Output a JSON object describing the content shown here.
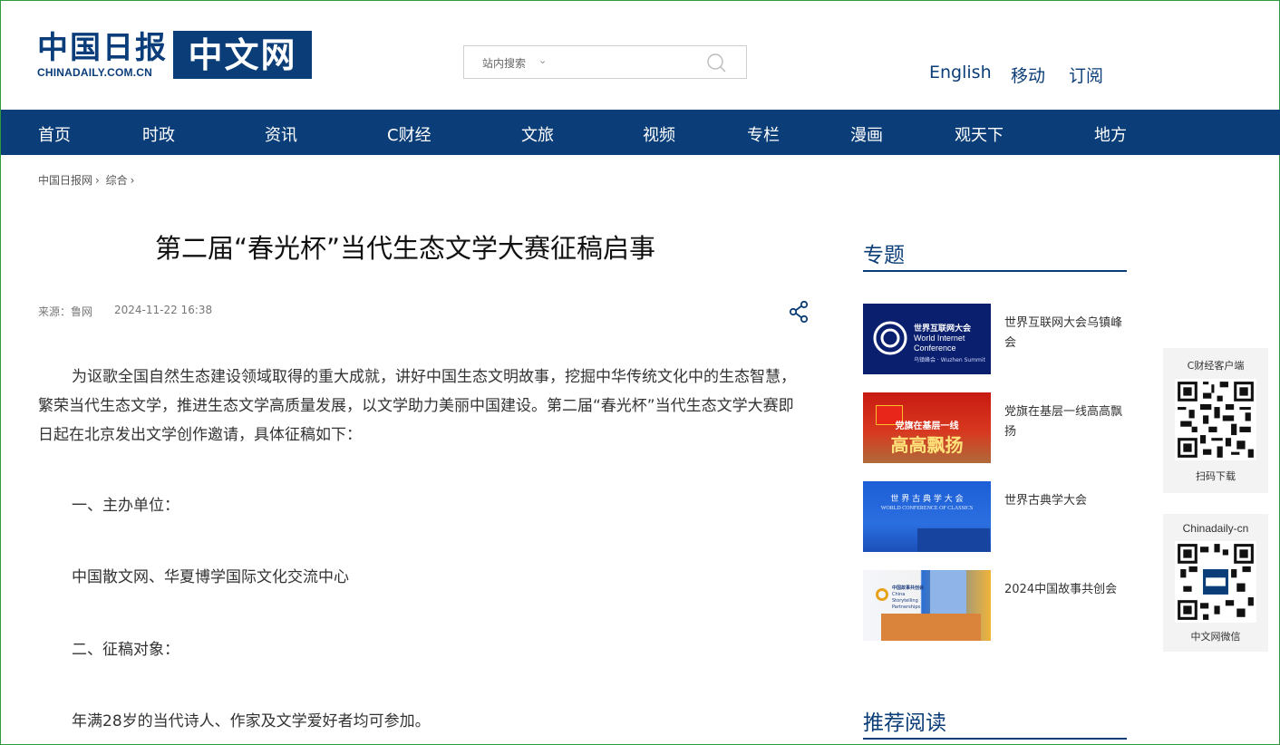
{
  "header": {
    "logo_cn": "中国日报",
    "logo_en": "CHINADAILY.COM.CN",
    "logo_box": "中文网",
    "search_scope": "站内搜索",
    "search_placeholder": "",
    "links": [
      "English",
      "移动",
      "订阅"
    ]
  },
  "nav": [
    "首页",
    "时政",
    "资讯",
    "C财经",
    "文旅",
    "视频",
    "专栏",
    "漫画",
    "观天下",
    "地方"
  ],
  "breadcrumb": [
    "中国日报网",
    "综合"
  ],
  "article": {
    "title": "第二届“春光杯”当代生态文学大赛征稿启事",
    "source": "来源：鲁网",
    "date": "2024-11-22 16:38",
    "paragraphs": [
      "为讴歌全国自然生态建设领域取得的重大成就，讲好中国生态文明故事，挖掘中华传统文化中的生态智慧，繁荣当代生态文学，推进生态文学高质量发展，以文学助力美丽中国建设。第二届“春光杯”当代生态文学大赛即日起在北京发出文学创作邀请，具体征稿如下：",
      "一、主办单位：",
      "中国散文网、华夏博学国际文化交流中心",
      "二、征稿对象：",
      "年满28岁的当代诗人、作家及文学爱好者均可参加。"
    ]
  },
  "sidebar": {
    "topics_title": "专题",
    "topics": [
      {
        "label": "世界互联网大会乌镇峰会",
        "img_text": [
          "世界互联网大会",
          "World Internet",
          "Conference",
          "乌镇峰会 · Wuzhen Summit"
        ]
      },
      {
        "label": "党旗在基层一线高高飘扬",
        "img_text": [
          "党旗在基层一线",
          "高高飘扬"
        ]
      },
      {
        "label": "世界古典学大会",
        "img_text": [
          "世 界 古 典 学 大 会",
          "WORLD CONFERENCE OF CLASSICS"
        ]
      },
      {
        "label": "2024中国故事共创会",
        "img_text": [
          "中国故事共创会",
          "China Storytelling Partnerships"
        ]
      }
    ],
    "recommend_title": "推荐阅读"
  },
  "qr_cards": [
    {
      "top_label": "C财经客户端",
      "bottom_label": "扫码下载"
    },
    {
      "top_label": "Chinadaily-cn",
      "bottom_label": "中文网微信"
    }
  ],
  "colors": {
    "brand": "#0b3e78",
    "page_border": "#2e9a3b"
  }
}
